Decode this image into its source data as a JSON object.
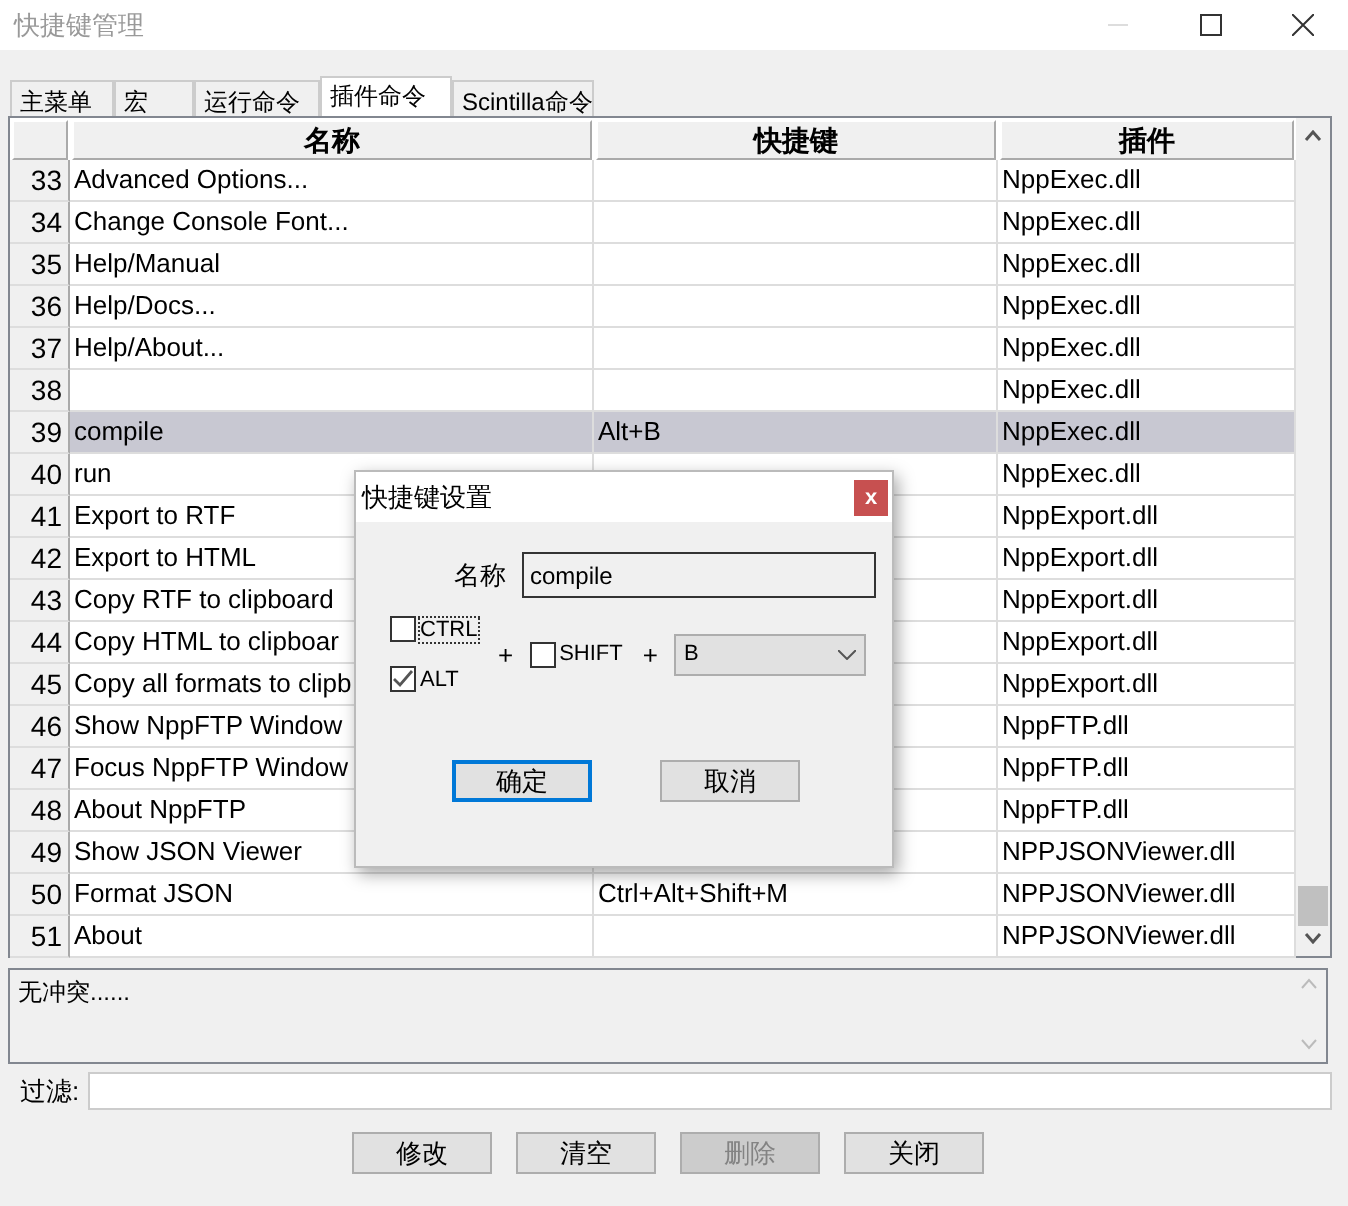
{
  "window": {
    "title": "快捷键管理"
  },
  "tabs": [
    {
      "label": "主菜单",
      "selected": false
    },
    {
      "label": "宏",
      "selected": false
    },
    {
      "label": "运行命令",
      "selected": false
    },
    {
      "label": "插件命令",
      "selected": true
    },
    {
      "label": "Scintilla命令",
      "selected": false
    }
  ],
  "table": {
    "columns": [
      "名称",
      "快捷键",
      "插件"
    ],
    "rows": [
      {
        "number": "33",
        "name": "Advanced Options...",
        "shortcut": "",
        "plugin": "NppExec.dll",
        "selected": false
      },
      {
        "number": "34",
        "name": "Change Console Font...",
        "shortcut": "",
        "plugin": "NppExec.dll",
        "selected": false
      },
      {
        "number": "35",
        "name": "Help/Manual",
        "shortcut": "",
        "plugin": "NppExec.dll",
        "selected": false
      },
      {
        "number": "36",
        "name": "Help/Docs...",
        "shortcut": "",
        "plugin": "NppExec.dll",
        "selected": false
      },
      {
        "number": "37",
        "name": "Help/About...",
        "shortcut": "",
        "plugin": "NppExec.dll",
        "selected": false
      },
      {
        "number": "38",
        "name": "",
        "shortcut": "",
        "plugin": "NppExec.dll",
        "selected": false
      },
      {
        "number": "39",
        "name": "compile",
        "shortcut": "Alt+B",
        "plugin": "NppExec.dll",
        "selected": true
      },
      {
        "number": "40",
        "name": "run",
        "shortcut": "",
        "plugin": "NppExec.dll",
        "selected": false
      },
      {
        "number": "41",
        "name": "Export to RTF",
        "shortcut": "",
        "plugin": "NppExport.dll",
        "selected": false
      },
      {
        "number": "42",
        "name": "Export to HTML",
        "shortcut": "",
        "plugin": "NppExport.dll",
        "selected": false
      },
      {
        "number": "43",
        "name": "Copy RTF to clipboard",
        "shortcut": "",
        "plugin": "NppExport.dll",
        "selected": false
      },
      {
        "number": "44",
        "name": "Copy HTML to clipboar",
        "shortcut": "",
        "plugin": "NppExport.dll",
        "selected": false
      },
      {
        "number": "45",
        "name": "Copy all formats to clipb",
        "shortcut": "",
        "plugin": "NppExport.dll",
        "selected": false
      },
      {
        "number": "46",
        "name": "Show NppFTP Window",
        "shortcut": "",
        "plugin": "NppFTP.dll",
        "selected": false
      },
      {
        "number": "47",
        "name": "Focus NppFTP Window",
        "shortcut": "",
        "plugin": "NppFTP.dll",
        "selected": false
      },
      {
        "number": "48",
        "name": "About NppFTP",
        "shortcut": "",
        "plugin": "NppFTP.dll",
        "selected": false
      },
      {
        "number": "49",
        "name": "Show JSON Viewer",
        "shortcut": "",
        "plugin": "NPPJSONViewer.dll",
        "selected": false
      },
      {
        "number": "50",
        "name": "Format JSON",
        "shortcut": "Ctrl+Alt+Shift+M",
        "plugin": "NPPJSONViewer.dll",
        "selected": false
      },
      {
        "number": "51",
        "name": "About",
        "shortcut": "",
        "plugin": "NPPJSONViewer.dll",
        "selected": false
      }
    ]
  },
  "conflict_message": "无冲突......",
  "filter": {
    "label": "过滤:"
  },
  "buttons": [
    {
      "label": "修改",
      "disabled": false
    },
    {
      "label": "清空",
      "disabled": false
    },
    {
      "label": "删除",
      "disabled": true
    },
    {
      "label": "关闭",
      "disabled": false
    }
  ],
  "dialog": {
    "title": "快捷键设置",
    "close": "x",
    "name_label": "名称",
    "name_value": "compile",
    "ctrl": {
      "label": "CTRL",
      "checked": false
    },
    "alt": {
      "label": "ALT",
      "checked": true
    },
    "shift": {
      "label": "SHIFT",
      "checked": false
    },
    "plus_1": "+",
    "plus_2": "+",
    "key": "B",
    "ok": "确定",
    "cancel": "取消"
  }
}
